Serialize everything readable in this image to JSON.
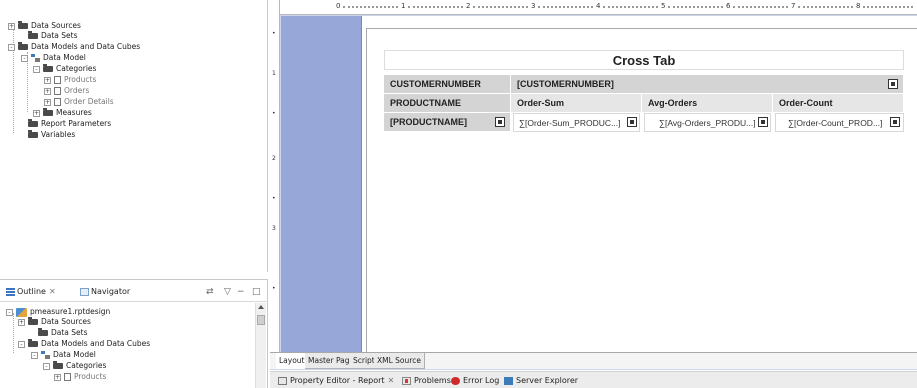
{
  "data_explorer": {
    "items": [
      {
        "label": "Data Sources",
        "icon": "folder-icon",
        "expander": "+"
      },
      {
        "label": "Data Sets",
        "icon": "folder-icon",
        "expander": ""
      },
      {
        "label": "Data Models and Data Cubes",
        "icon": "folder-icon",
        "expander": "-"
      },
      {
        "label": "Data Model",
        "icon": "data-model-icon",
        "expander": "-"
      },
      {
        "label": "Categories",
        "icon": "folder-icon",
        "expander": "-"
      },
      {
        "label": "Products",
        "icon": "document-icon",
        "expander": "+"
      },
      {
        "label": "Orders",
        "icon": "document-icon",
        "expander": "+"
      },
      {
        "label": "Order Details",
        "icon": "document-icon",
        "expander": "+"
      },
      {
        "label": "Measures",
        "icon": "folder-icon",
        "expander": "+"
      },
      {
        "label": "Report Parameters",
        "icon": "folder-icon",
        "expander": ""
      },
      {
        "label": "Variables",
        "icon": "folder-icon",
        "expander": ""
      }
    ]
  },
  "outline": {
    "tabs": [
      {
        "label": "Outline",
        "icon": "outline-icon",
        "close": "✕"
      },
      {
        "label": "Navigator",
        "icon": "navigator-icon"
      }
    ],
    "toolbar": {
      "view_menu": "▽",
      "minimize": "−",
      "maximize": "□",
      "link": "⇄"
    },
    "items": [
      {
        "label": "pmeasure1.rptdesign",
        "icon": "report-design-icon",
        "expander": "-"
      },
      {
        "label": "Data Sources",
        "icon": "folder-icon",
        "expander": "+"
      },
      {
        "label": "Data Sets",
        "icon": "folder-icon",
        "expander": ""
      },
      {
        "label": "Data Models and Data Cubes",
        "icon": "folder-icon",
        "expander": "-"
      },
      {
        "label": "Data Model",
        "icon": "data-model-icon",
        "expander": "-"
      },
      {
        "label": "Categories",
        "icon": "folder-icon",
        "expander": "-"
      },
      {
        "label": "Products",
        "icon": "document-icon",
        "expander": "+"
      }
    ]
  },
  "editor": {
    "ruler_numbers": [
      "0",
      "1",
      "2",
      "3",
      "4",
      "5",
      "6",
      "7",
      "8"
    ],
    "ruler_left_marks": [
      "•",
      "1",
      "•",
      "2",
      "•",
      "3",
      "•"
    ],
    "crosstab": {
      "title": "Cross Tab",
      "rows": [
        {
          "cells": [
            {
              "text": "CUSTOMERNUMBER",
              "style": "gray"
            },
            {
              "text": "[CUSTOMERNUMBER]",
              "style": "gray",
              "handle": true
            }
          ]
        },
        {
          "cells": [
            {
              "text": "PRODUCTNAME",
              "style": "gray"
            },
            {
              "text": "Order-Sum",
              "style": "light"
            },
            {
              "text": "Avg-Orders",
              "style": "light"
            },
            {
              "text": "Order-Count",
              "style": "light"
            }
          ]
        },
        {
          "cells": [
            {
              "text": "[PRODUCTNAME]",
              "style": "gray",
              "handle": true
            },
            {
              "text": "∑[Order-Sum_PRODUC...]",
              "style": "data",
              "handle": true
            },
            {
              "text": "∑[Avg-Orders_PRODU...]",
              "style": "data",
              "handle": true
            },
            {
              "text": "∑[Order-Count_PROD...]",
              "style": "data",
              "handle": true
            }
          ]
        }
      ]
    },
    "tabs": [
      {
        "label": "Layout",
        "active": true
      },
      {
        "label": "Master Page",
        "active": false
      },
      {
        "label": "Script",
        "active": false
      },
      {
        "label": "XML Source",
        "active": false
      }
    ]
  },
  "bottom_views": [
    {
      "label": "Property Editor - Report",
      "icon": "property-editor-icon",
      "close": "✕"
    },
    {
      "label": "Problems",
      "icon": "problems-icon"
    },
    {
      "label": "Error Log",
      "icon": "error-log-icon"
    },
    {
      "label": "Server Explorer",
      "icon": "server-explorer-icon"
    }
  ]
}
